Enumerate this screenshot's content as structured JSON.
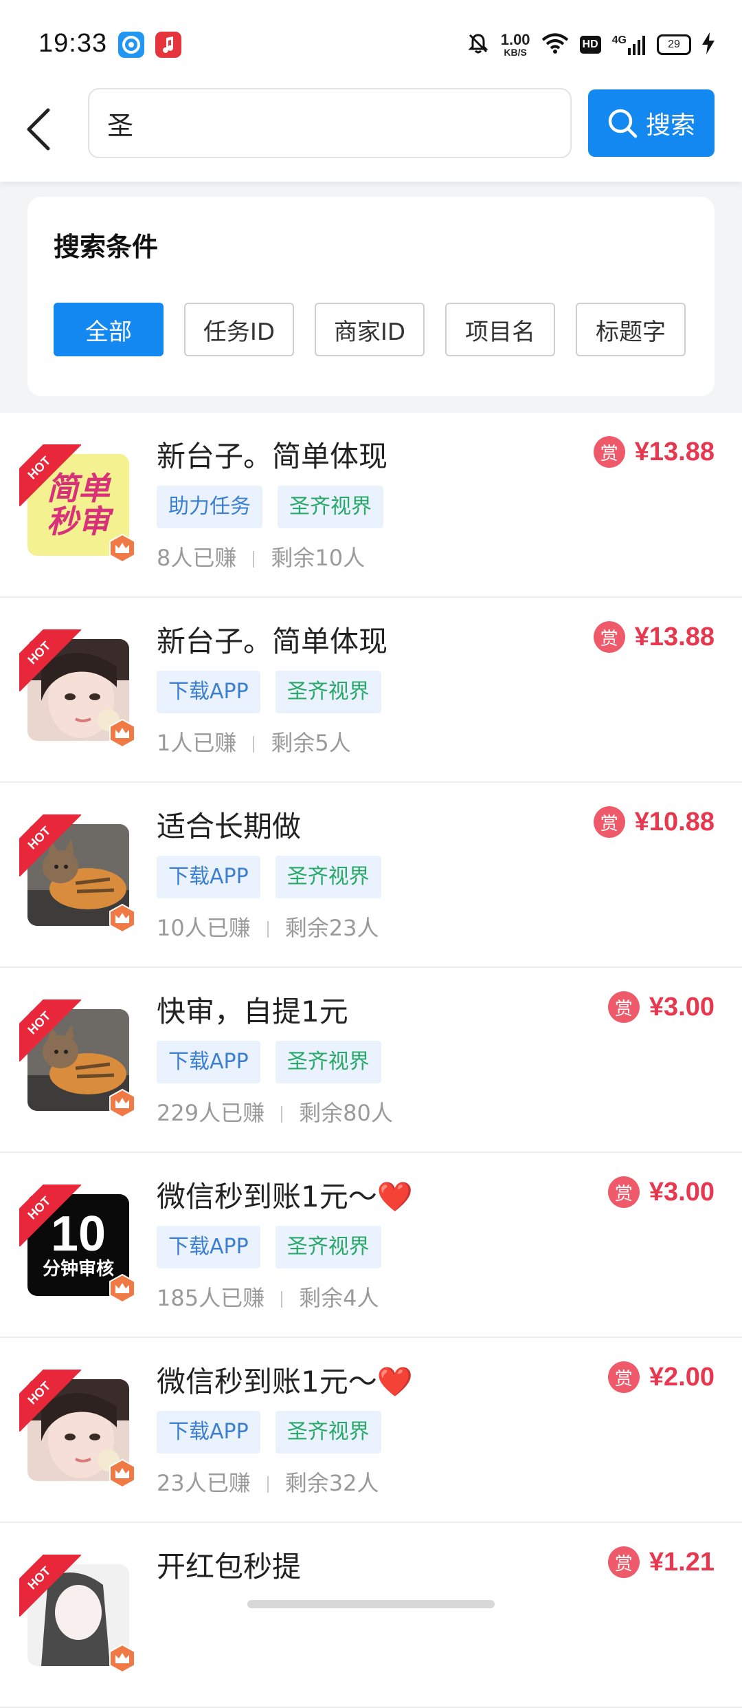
{
  "status": {
    "time": "19:33",
    "speed_value": "1.00",
    "speed_unit": "KB/S",
    "hd": "HD",
    "network": "4G",
    "battery": "29"
  },
  "search": {
    "query": "圣",
    "button_label": "搜索"
  },
  "filter": {
    "title": "搜索条件",
    "chips": [
      "全部",
      "任务ID",
      "商家ID",
      "项目名",
      "标题字"
    ],
    "active_index": 0
  },
  "colors": {
    "primary": "#1388f0",
    "reward": "#e8384f",
    "hot": "#e8283a"
  },
  "tasks": [
    {
      "title": "新台子。简单体现",
      "tag1": "助力任务",
      "tag2": "圣齐视界",
      "earned": "8人已赚",
      "remaining": "剩余10人",
      "reward_badge": "赏",
      "reward": "¥13.88",
      "thumb": "yellow-text",
      "thumb_line1": "简单",
      "thumb_line2": "秒审",
      "hot": "HOT"
    },
    {
      "title": "新台子。简单体现",
      "tag1": "下载APP",
      "tag2": "圣齐视界",
      "earned": "1人已赚",
      "remaining": "剩余5人",
      "reward_badge": "赏",
      "reward": "¥13.88",
      "thumb": "portrait",
      "hot": "HOT"
    },
    {
      "title": "适合长期做",
      "tag1": "下载APP",
      "tag2": "圣齐视界",
      "earned": "10人已赚",
      "remaining": "剩余23人",
      "reward_badge": "赏",
      "reward": "¥10.88",
      "thumb": "cat",
      "hot": "HOT"
    },
    {
      "title": "快审，自提1元",
      "tag1": "下载APP",
      "tag2": "圣齐视界",
      "earned": "229人已赚",
      "remaining": "剩余80人",
      "reward_badge": "赏",
      "reward": "¥3.00",
      "thumb": "cat",
      "hot": "HOT"
    },
    {
      "title": "微信秒到账1元～❤️",
      "tag1": "下载APP",
      "tag2": "圣齐视界",
      "earned": "185人已赚",
      "remaining": "剩余4人",
      "reward_badge": "赏",
      "reward": "¥3.00",
      "thumb": "black-10",
      "thumb_line1": "10",
      "thumb_line2": "分钟审核",
      "hot": "HOT"
    },
    {
      "title": "微信秒到账1元～❤️",
      "tag1": "下载APP",
      "tag2": "圣齐视界",
      "earned": "23人已赚",
      "remaining": "剩余32人",
      "reward_badge": "赏",
      "reward": "¥2.00",
      "thumb": "portrait",
      "hot": "HOT"
    },
    {
      "title": "开红包秒提",
      "tag1": "",
      "tag2": "",
      "earned": "",
      "remaining": "",
      "reward_badge": "赏",
      "reward": "¥1.21",
      "thumb": "sketch",
      "hot": "HOT"
    }
  ]
}
